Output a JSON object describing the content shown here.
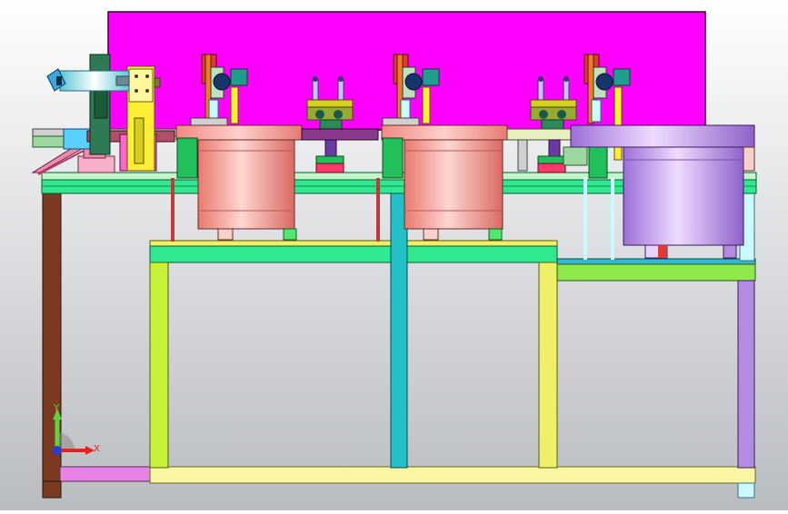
{
  "viewport": {
    "background_top": "#ffffff",
    "background_bottom": "#b9bcc1"
  },
  "triad": {
    "x_label": "X",
    "y_label": "Y",
    "x_color": "#e0241f",
    "y_color": "#5fd43a",
    "z_color": "#2a3bd6"
  },
  "colors": {
    "back_panel": "#ff00ff",
    "frame_green": "#2fe88f",
    "frame_teal": "#21c1c7",
    "frame_yellow": "#f0f066",
    "frame_lime": "#c6f23a",
    "frame_brown": "#7a3a20",
    "frame_pink": "#e982e5",
    "frame_lavender": "#b58be0",
    "bowl_salmon": "#f7a4a0",
    "bowl_purple": "#c79af0",
    "cylinder_cyan": "#c8faff",
    "motor_navy": "#16356b",
    "accent_red": "#e23a30",
    "accent_orange": "#f07a2a",
    "accent_yellow": "#ffee33"
  }
}
